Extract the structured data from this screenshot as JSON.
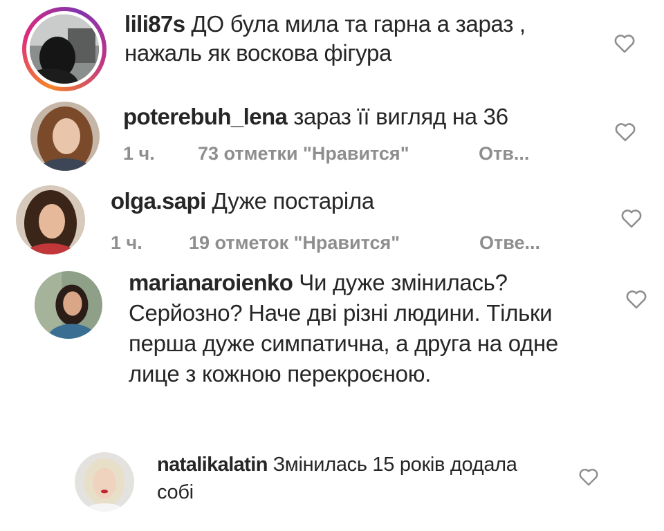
{
  "comments": [
    {
      "username": "lili87s",
      "text": "ДО була мила та гарна а зараз , нажаль як воскова фігура",
      "has_story_ring": true
    },
    {
      "username": "poterebuh_lena",
      "text": "зараз її вигляд на 36",
      "time": "1 ч.",
      "likes": "73 отметки \"Нравится\"",
      "reply": "Отв..."
    },
    {
      "username": "olga.sapi",
      "text": "Дуже постаріла",
      "time": "1 ч.",
      "likes": "19 отметок \"Нравится\"",
      "reply": "Отве..."
    },
    {
      "username": "marianaroienko",
      "text": "Чи дуже змінилась? Серйозно? Наче дві різні людини. Тільки перша дуже  симпатична, а друга на одне лице з кожною перекроєною."
    },
    {
      "username": "natalikalatin",
      "text": "Змінилась 15 років додала собі"
    }
  ],
  "colors": {
    "text": "#262626",
    "meta": "#8e8e8e",
    "heart": "#8e8e8e",
    "story_ring_start": "#f58529",
    "story_ring_end": "#8134af"
  },
  "icons": {
    "like": "heart-outline-icon",
    "avatar": "user-avatar"
  }
}
